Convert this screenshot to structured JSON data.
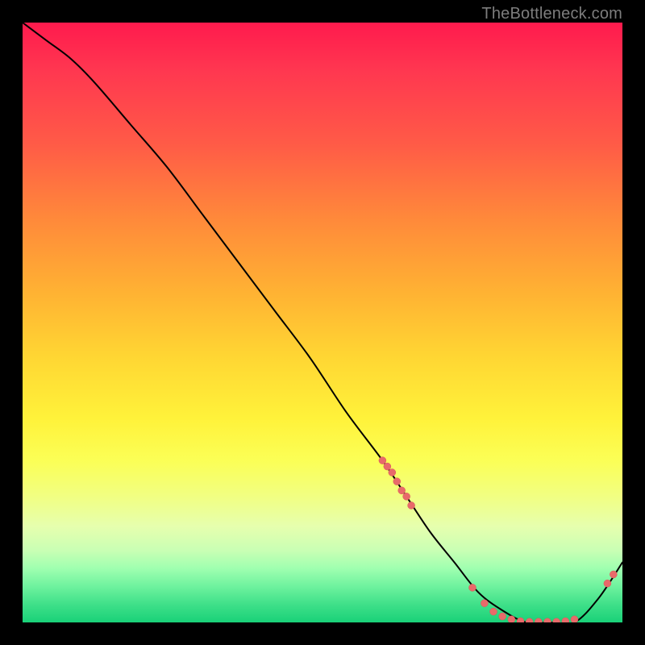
{
  "watermark": "TheBottleneck.com",
  "colors": {
    "curve_stroke": "#000000",
    "dot_fill": "#e86a6a",
    "dot_stroke": "#d85a5a"
  },
  "chart_data": {
    "type": "line",
    "title": "",
    "xlabel": "",
    "ylabel": "",
    "xlim": [
      0,
      100
    ],
    "ylim": [
      0,
      100
    ],
    "x": [
      0,
      4,
      8,
      12,
      18,
      24,
      30,
      36,
      42,
      48,
      54,
      60,
      64,
      68,
      72,
      76,
      80,
      84,
      88,
      92,
      96,
      100
    ],
    "values": [
      100,
      97,
      94,
      90,
      83,
      76,
      68,
      60,
      52,
      44,
      35,
      27,
      21,
      15,
      10,
      5,
      2,
      0,
      0,
      0,
      4,
      10
    ],
    "dots": [
      {
        "x": 60.0,
        "y": 27
      },
      {
        "x": 60.8,
        "y": 26
      },
      {
        "x": 61.6,
        "y": 25
      },
      {
        "x": 62.4,
        "y": 23.5
      },
      {
        "x": 63.2,
        "y": 22
      },
      {
        "x": 64.0,
        "y": 21
      },
      {
        "x": 64.8,
        "y": 19.5
      },
      {
        "x": 75.0,
        "y": 5.8
      },
      {
        "x": 77.0,
        "y": 3.2
      },
      {
        "x": 78.5,
        "y": 1.8
      },
      {
        "x": 80.0,
        "y": 1.0
      },
      {
        "x": 81.5,
        "y": 0.5
      },
      {
        "x": 83.0,
        "y": 0.2
      },
      {
        "x": 84.5,
        "y": 0.1
      },
      {
        "x": 86.0,
        "y": 0.1
      },
      {
        "x": 87.5,
        "y": 0.1
      },
      {
        "x": 89.0,
        "y": 0.1
      },
      {
        "x": 90.5,
        "y": 0.2
      },
      {
        "x": 92.0,
        "y": 0.5
      },
      {
        "x": 97.5,
        "y": 6.5
      },
      {
        "x": 98.5,
        "y": 8.0
      }
    ]
  }
}
